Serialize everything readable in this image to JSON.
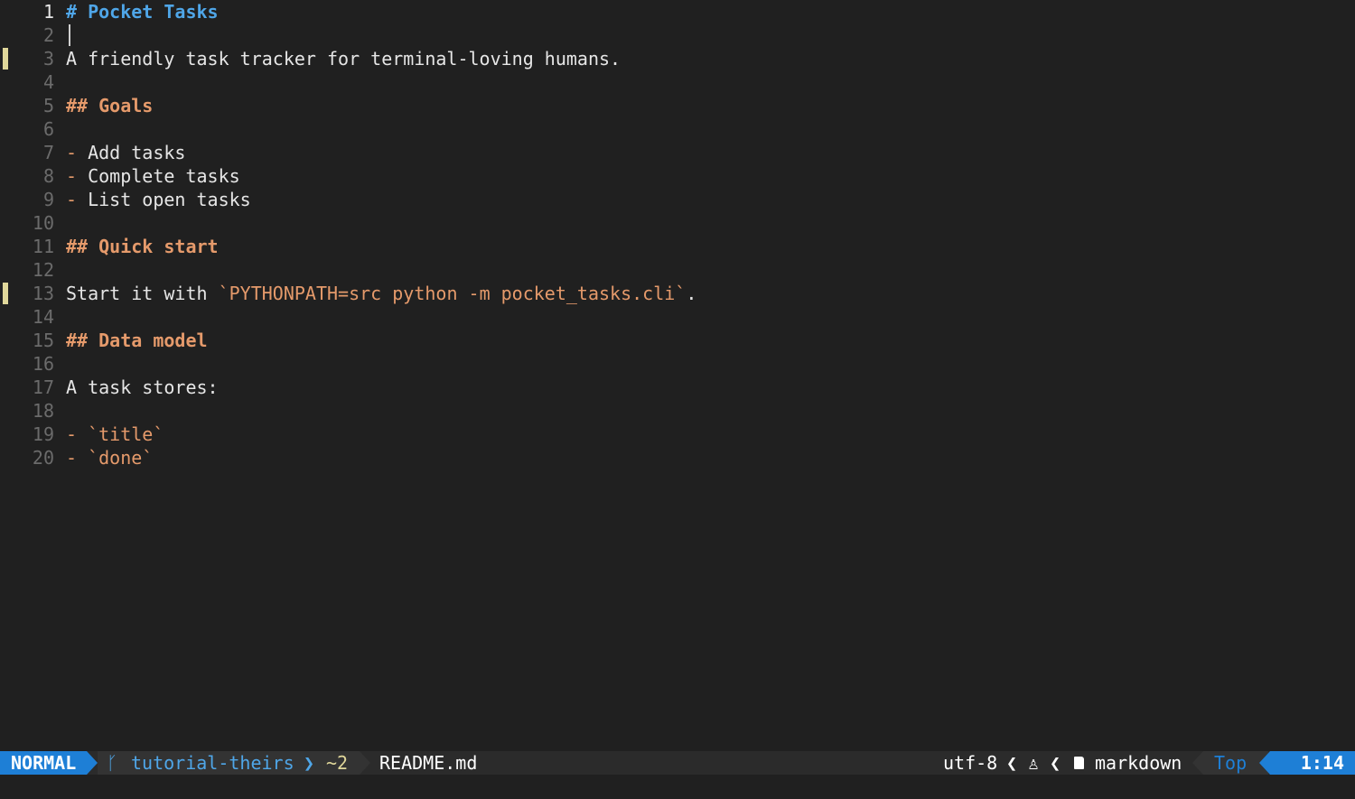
{
  "editor": {
    "lines": [
      {
        "num": "1",
        "current": true,
        "segments": [
          {
            "text": "# Pocket Tasks",
            "style": "h1"
          }
        ]
      },
      {
        "num": "2",
        "cursor": true,
        "segments": []
      },
      {
        "num": "3",
        "git_mark": true,
        "segments": [
          {
            "text": "A friendly task tracker for terminal-loving humans.",
            "style": "text"
          }
        ]
      },
      {
        "num": "4",
        "segments": []
      },
      {
        "num": "5",
        "segments": [
          {
            "text": "## Goals",
            "style": "h2"
          }
        ]
      },
      {
        "num": "6",
        "segments": []
      },
      {
        "num": "7",
        "segments": [
          {
            "text": "- ",
            "style": "bullet"
          },
          {
            "text": "Add tasks",
            "style": "text"
          }
        ]
      },
      {
        "num": "8",
        "segments": [
          {
            "text": "- ",
            "style": "bullet"
          },
          {
            "text": "Complete tasks",
            "style": "text"
          }
        ]
      },
      {
        "num": "9",
        "segments": [
          {
            "text": "- ",
            "style": "bullet"
          },
          {
            "text": "List open tasks",
            "style": "text"
          }
        ]
      },
      {
        "num": "10",
        "segments": []
      },
      {
        "num": "11",
        "segments": [
          {
            "text": "## Quick start",
            "style": "h2"
          }
        ]
      },
      {
        "num": "12",
        "segments": []
      },
      {
        "num": "13",
        "git_mark": true,
        "segments": [
          {
            "text": "Start it with ",
            "style": "text"
          },
          {
            "text": "`PYTHONPATH=src python -m pocket_tasks.cli`",
            "style": "code"
          },
          {
            "text": ".",
            "style": "text"
          }
        ]
      },
      {
        "num": "14",
        "segments": []
      },
      {
        "num": "15",
        "segments": [
          {
            "text": "## Data model",
            "style": "h2"
          }
        ]
      },
      {
        "num": "16",
        "segments": []
      },
      {
        "num": "17",
        "segments": [
          {
            "text": "A task stores:",
            "style": "text"
          }
        ]
      },
      {
        "num": "18",
        "segments": []
      },
      {
        "num": "19",
        "segments": [
          {
            "text": "- ",
            "style": "bullet"
          },
          {
            "text": "`title`",
            "style": "code"
          }
        ]
      },
      {
        "num": "20",
        "segments": [
          {
            "text": "- ",
            "style": "bullet"
          },
          {
            "text": "`done`",
            "style": "code"
          }
        ]
      }
    ]
  },
  "statusline": {
    "mode": "NORMAL",
    "branch": "tutorial-theirs",
    "changes": "~2",
    "filename": "README.md",
    "encoding": "utf-8",
    "filetype": "markdown",
    "position": "Top",
    "line_col": "1:14"
  },
  "colors": {
    "accent_blue": "#1e7fd6",
    "heading1": "#4fa6e8",
    "heading2": "#e59a6b",
    "git_mark": "#e0d79a",
    "background": "#202020"
  }
}
